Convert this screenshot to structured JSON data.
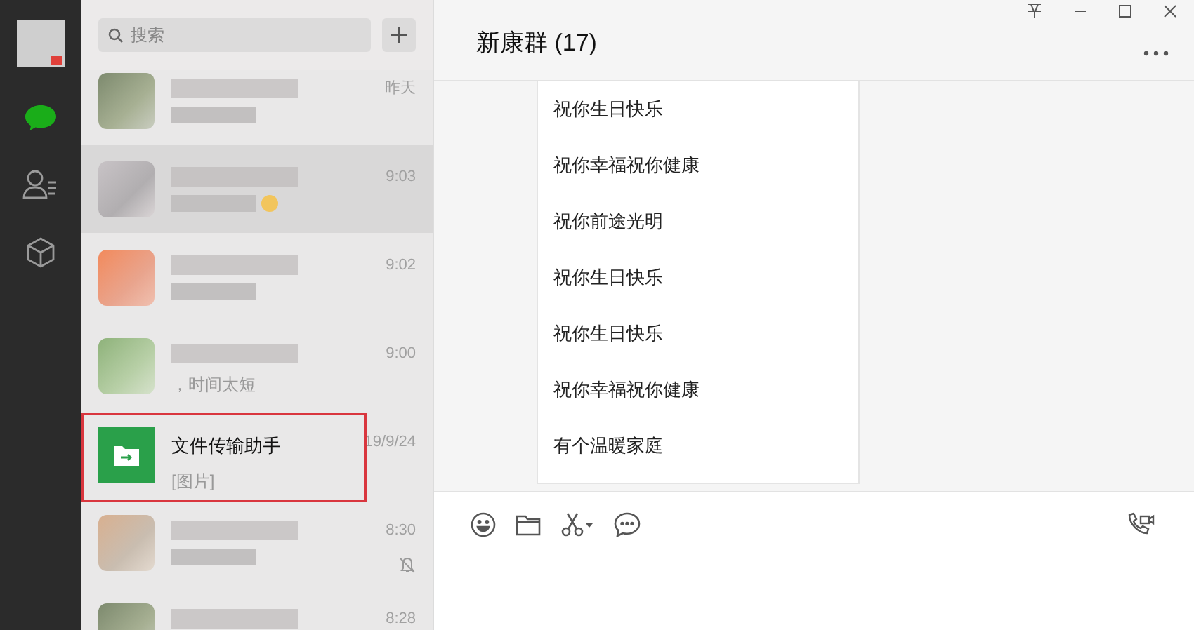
{
  "search": {
    "placeholder": "搜索"
  },
  "chats": [
    {
      "kind": "blurred",
      "time": "昨天",
      "selected": false,
      "highlighted": false,
      "muted": false
    },
    {
      "kind": "blurred",
      "time": "9:03",
      "selected": true,
      "highlighted": false,
      "muted": false,
      "emoji": true
    },
    {
      "kind": "blurred",
      "time": "9:02",
      "selected": false,
      "highlighted": false,
      "muted": false
    },
    {
      "kind": "blurred",
      "time": "9:00",
      "preview": "，时间太短",
      "selected": false,
      "highlighted": false,
      "muted": false
    },
    {
      "kind": "file",
      "name": "文件传输助手",
      "preview": "[图片]",
      "time": "19/9/24",
      "selected": false,
      "highlighted": true,
      "muted": false
    },
    {
      "kind": "blurred",
      "time": "8:30",
      "selected": false,
      "highlighted": false,
      "muted": true
    },
    {
      "kind": "blurred",
      "time": "8:28",
      "selected": false,
      "highlighted": false
    }
  ],
  "chat": {
    "title": "新康群 (17)",
    "messages": [
      "祝你生日快乐",
      "祝你幸福祝你健康",
      "祝你前途光明",
      "祝你生日快乐",
      "祝你生日快乐",
      "祝你幸福祝你健康",
      "有个温暖家庭"
    ]
  }
}
